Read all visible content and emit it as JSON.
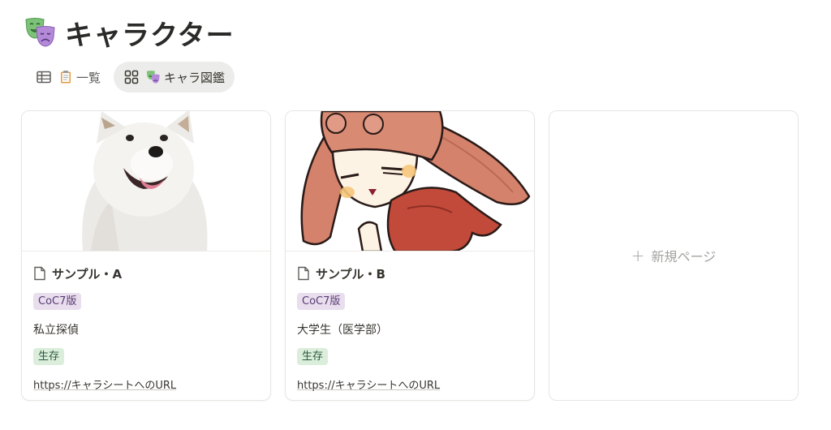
{
  "page": {
    "title": "キャラクター",
    "icon": "theater-masks-icon"
  },
  "tabs": [
    {
      "label": "一覧",
      "icon": "table-icon",
      "emoji": "clipboard-icon",
      "active": false
    },
    {
      "label": "キャラ図鑑",
      "icon": "gallery-icon",
      "emoji": "theater-masks-icon",
      "active": true
    }
  ],
  "cards": [
    {
      "title": "サンプル・A",
      "cover": "white-dog-photo",
      "tag_edition": "CoC7版",
      "occupation": "私立探偵",
      "status": "生存",
      "url": "https://キャラシートへのURL"
    },
    {
      "title": "サンプル・B",
      "cover": "anime-bunny-girl-illustration",
      "tag_edition": "CoC7版",
      "occupation": "大学生（医学部）",
      "status": "生存",
      "url": "https://キャラシートへのURL"
    }
  ],
  "new_page": {
    "plus": "+",
    "label": "新規ページ"
  },
  "colors": {
    "tag_purple_bg": "#e8deee",
    "tag_green_bg": "#dbeddb",
    "active_tab_bg": "#ececea"
  }
}
